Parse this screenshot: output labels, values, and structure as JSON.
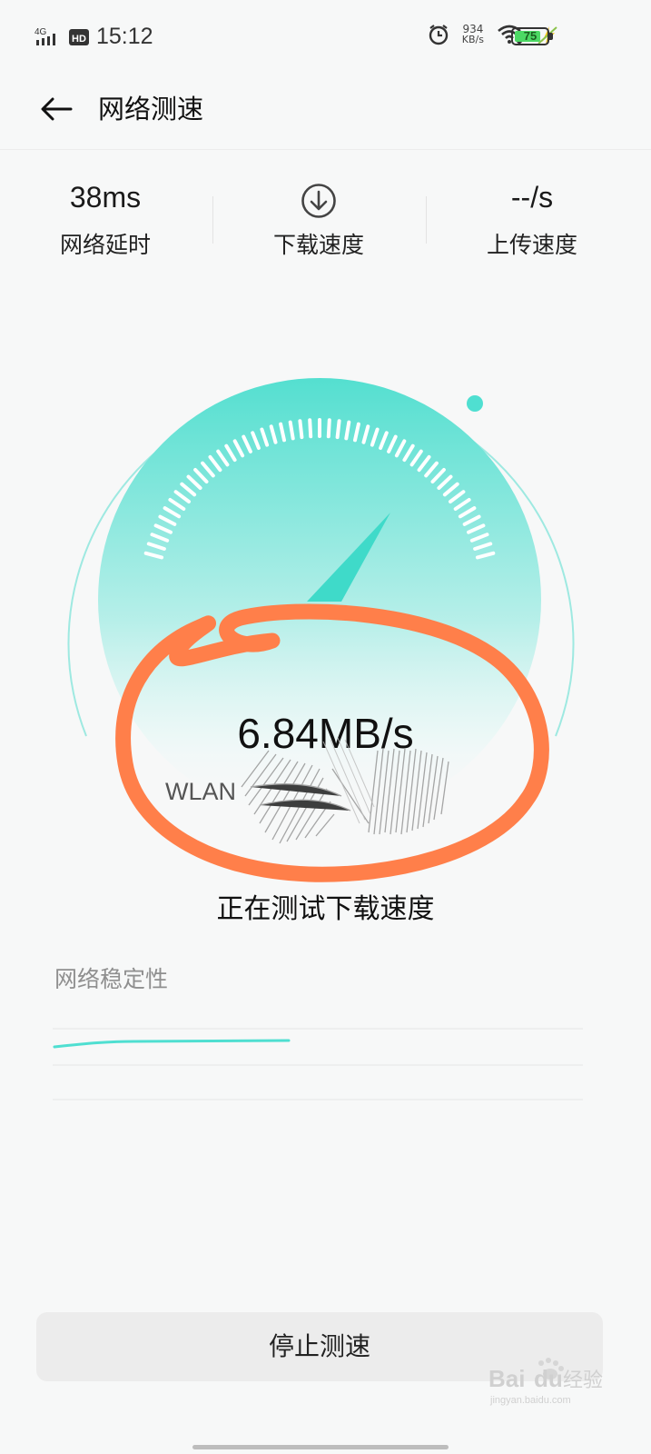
{
  "status_bar": {
    "signal": "4G",
    "hd": "HD",
    "time": "15:12",
    "net_rate_value": "934",
    "net_rate_unit": "KB/s",
    "battery": "75",
    "icons": [
      "signal-icon",
      "hd-icon",
      "alarm-icon",
      "wifi-icon",
      "charging-icon",
      "battery-icon"
    ]
  },
  "app_bar": {
    "title": "网络测速",
    "back_icon": "arrow-left-icon"
  },
  "stats": {
    "latency_value": "38ms",
    "latency_label": "网络延时",
    "download_icon": "download-arrow-icon",
    "download_label": "下载速度",
    "upload_value": "--/s",
    "upload_label": "上传速度"
  },
  "gauge": {
    "speed": "6.84MB/s",
    "network_name": "WLAN",
    "accent": "#4fdfd1",
    "needle_fraction": 0.62
  },
  "status_text": "正在测试下载速度",
  "stability": {
    "label": "网络稳定性",
    "line_color": "#4fdfd1"
  },
  "stop_button": "停止测速",
  "watermark": {
    "brand": "Bai",
    "brand_tail": "du",
    "cn": "经验",
    "url": "jingyan.baidu.com"
  },
  "annotation_color": "#ff7f4a"
}
